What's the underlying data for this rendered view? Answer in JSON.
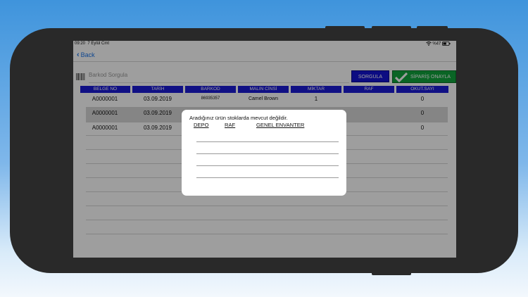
{
  "status_bar": {
    "time": "09:20",
    "date": "7 Eylül Cmt",
    "battery": "%47",
    "icons": [
      "wifi-icon",
      "battery-icon"
    ]
  },
  "nav": {
    "back_label": "Back"
  },
  "search": {
    "placeholder": "Barkod Sorgula"
  },
  "buttons": {
    "sorgula": "SORGULA",
    "siparis_onayla": "SİPARİŞ ONAYLA"
  },
  "colors": {
    "header_blue": "#1a1ad6",
    "button_blue": "#1414d2",
    "button_green": "#11a33d",
    "link_blue": "#1a73e8"
  },
  "table": {
    "headers": [
      "BELGE NO",
      "TARİH",
      "BARKOD",
      "MALIN CİNSİ",
      "MİKTAR",
      "RAF",
      "OKUT.SAYI"
    ],
    "rows": [
      {
        "belge_no": "A0000001",
        "tarih": "03.09.2019",
        "barkod": "86935357",
        "malin_cinsi": "Camel Brown",
        "miktar": "1",
        "raf": "",
        "okut_sayi": "0"
      },
      {
        "belge_no": "A0000001",
        "tarih": "03.09.2019",
        "barkod": "",
        "malin_cinsi": "",
        "miktar": "",
        "raf": "",
        "okut_sayi": "0"
      },
      {
        "belge_no": "A0000001",
        "tarih": "03.09.2019",
        "barkod": "",
        "malin_cinsi": "",
        "miktar": "",
        "raf": "",
        "okut_sayi": "0"
      }
    ]
  },
  "modal": {
    "message": "Aradığınız ürün stoklarda mevcut değildir.",
    "columns": [
      "DEPO",
      "RAF",
      "GENEL ENVANTER"
    ]
  }
}
